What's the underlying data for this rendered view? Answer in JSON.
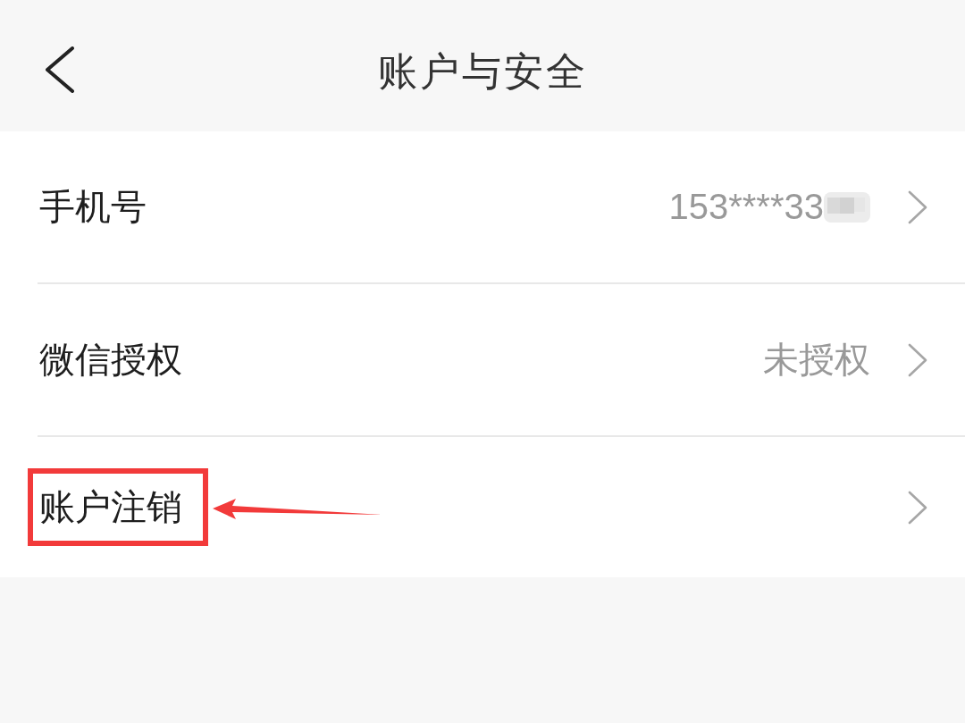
{
  "header": {
    "title": "账户与安全"
  },
  "rows": [
    {
      "label": "手机号",
      "value": "153****33",
      "redacted": true,
      "highlighted": false
    },
    {
      "label": "微信授权",
      "value": "未授权",
      "redacted": false,
      "highlighted": false
    },
    {
      "label": "账户注销",
      "redacted": false,
      "highlighted": true
    }
  ]
}
